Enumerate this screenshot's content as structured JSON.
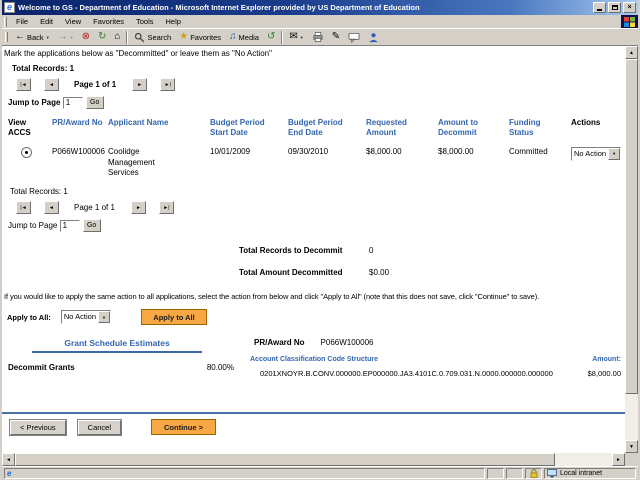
{
  "window": {
    "title": "Welcome to GS - Department of Education - Microsoft Internet Explorer provided by US Department of Education",
    "menus": [
      "File",
      "Edit",
      "View",
      "Favorites",
      "Tools",
      "Help"
    ],
    "toolbar": {
      "back_label": "Back",
      "search_label": "Search",
      "favorites_label": "Favorites",
      "media_label": "Media"
    }
  },
  "icons": {
    "ie_logo": "e",
    "close": "×",
    "dropdown_small": "▼",
    "back_arrow": "←",
    "forward_arrow": "→",
    "stop": "⊗",
    "refresh": "↻",
    "home": "⌂",
    "favorites_star": "★",
    "media_note": "♫",
    "history": "↺",
    "mail_envelope": "✉",
    "edit_pencil": "✎",
    "pager_first": "|◄",
    "pager_prev": "◄",
    "pager_next": "►",
    "pager_last": "►|",
    "scroll_up": "▲",
    "scroll_down": "▼",
    "scroll_left": "◄",
    "scroll_right": "►"
  },
  "page": {
    "instruction_top": "Mark the applications below as \"Decommitted\" or leave them as \"No Action\"",
    "pager_top": {
      "total_records": "Total Records: 1",
      "page_label": "Page 1 of 1",
      "jump_label": "Jump to Page",
      "jump_value": "1",
      "go_label": "Go"
    },
    "pager_bottom": {
      "total_records": "Total Records: 1",
      "page_label": "Page 1 of 1",
      "jump_label": "Jump to Page",
      "jump_value": "1",
      "go_label": "Go"
    },
    "table": {
      "headers": [
        "View\nACCS",
        "PR/Award No",
        "Applicant Name",
        "Budget Period\nStart Date",
        "Budget Period\nEnd Date",
        "Requested\nAmount",
        "Amount to\nDecommit",
        "Funding\nStatus",
        "Actions"
      ],
      "row": {
        "pr_award_no": "P066W100006",
        "applicant_name": "Coolidge Management Services",
        "budget_start": "10/01/2009",
        "budget_end": "09/30/2010",
        "requested_amount": "$8,000.00",
        "amount_to_decommit": "$8,000.00",
        "funding_status": "Committed",
        "action_value": "No Action"
      }
    },
    "totals": {
      "records_label": "Total Records to Decommit",
      "records_value": "0",
      "amount_label": "Total Amount Decommitted",
      "amount_value": "$0.00"
    },
    "apply_all": {
      "instruction": "If you would like to apply the same action to all applications, select the action from below and click \"Apply to All\" (note that this does not save, click \"Continue\" to save).",
      "label": "Apply to All:",
      "select_value": "No Action",
      "button_label": "Apply to All"
    },
    "schedule": {
      "heading": "Grant Schedule Estimates",
      "decommit_label": "Decommit Grants",
      "decommit_value": "80.00%",
      "award_label": "PR/Award No",
      "award_value": "P066W100006",
      "accs_label": "Account Classification Code Structure",
      "amount_label": "Amount:",
      "accs_value": "0201XNOYR.B.CONV.000000.EP000000.JA3.4101C.0.709.031.N.0000.000000.000000",
      "amount_value": "$8,000.00"
    },
    "nav": {
      "previous": "< Previous",
      "cancel": "Cancel",
      "continue": "Continue >"
    }
  },
  "status_bar": {
    "zone_label": "Local intranet"
  },
  "colors": {
    "link_blue": "#3366B0",
    "accent_orange": "#F7A845",
    "titlebar_left": "#0A246A",
    "titlebar_right": "#A6CAF0",
    "chrome_gray": "#D4D0C8",
    "rule_blue": "#4A70A8"
  }
}
